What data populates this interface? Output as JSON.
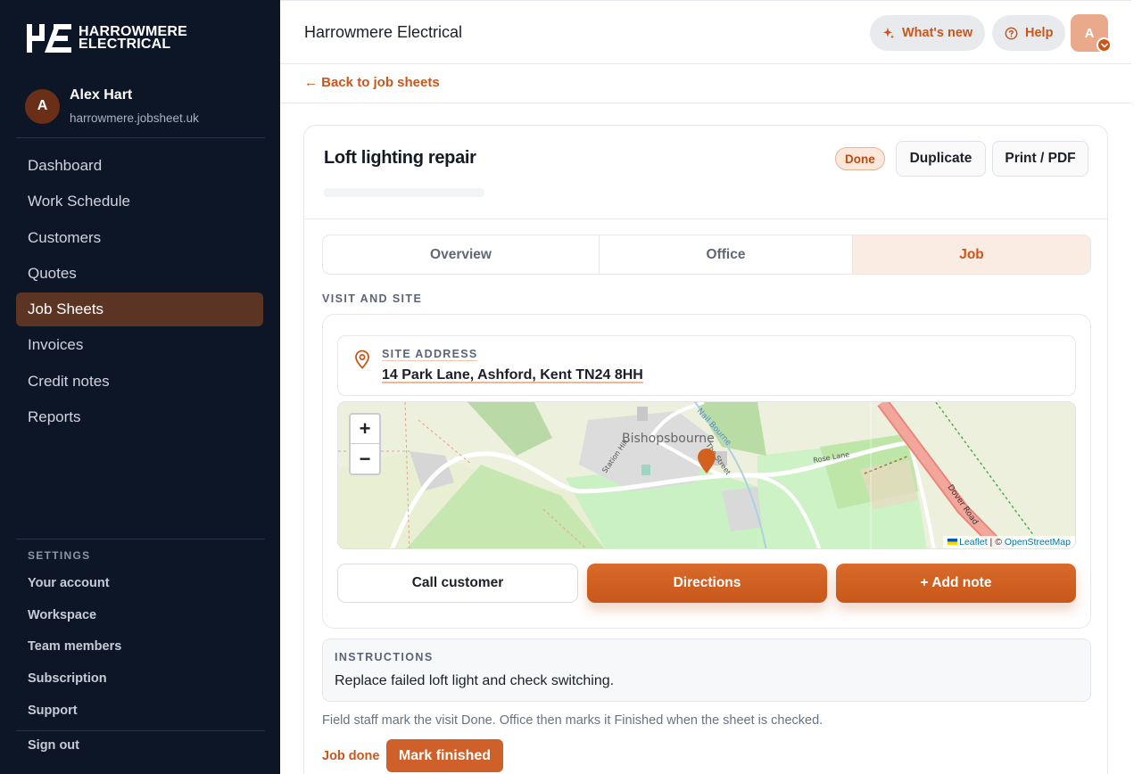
{
  "brand": {
    "line1": "HARROWMERE",
    "line2": "ELECTRICAL"
  },
  "user": {
    "initial": "A",
    "name": "Alex Hart",
    "domain": "harrowmere.jobsheet.uk"
  },
  "nav": [
    {
      "label": "Dashboard",
      "active": false
    },
    {
      "label": "Work Schedule",
      "active": false
    },
    {
      "label": "Customers",
      "active": false
    },
    {
      "label": "Quotes",
      "active": false
    },
    {
      "label": "Job Sheets",
      "active": true
    },
    {
      "label": "Invoices",
      "active": false
    },
    {
      "label": "Credit notes",
      "active": false
    },
    {
      "label": "Reports",
      "active": false
    }
  ],
  "settings": {
    "heading": "SETTINGS",
    "items": [
      "Your account",
      "Workspace",
      "Team members",
      "Subscription",
      "Support"
    ],
    "sign_out": "Sign out"
  },
  "topbar": {
    "title": "Harrowmere Electrical",
    "whats_new": "What's new",
    "help": "Help",
    "avatar_initial": "A"
  },
  "back_link": "← Back to job sheets",
  "job": {
    "title": "Loft lighting repair",
    "status": "Done",
    "duplicate": "Duplicate",
    "print": "Print / PDF"
  },
  "tabs": [
    {
      "label": "Overview",
      "active": false
    },
    {
      "label": "Office",
      "active": false
    },
    {
      "label": "Job",
      "active": true
    }
  ],
  "visit": {
    "section_label": "VISIT AND SITE",
    "address_label": "SITE ADDRESS",
    "address": "14 Park Lane, Ashford, Kent TN24 8HH",
    "map": {
      "place": "Bishopsbourne",
      "roads": [
        "Station Hill",
        "The Street",
        "Rose Lane",
        "Dover Road",
        "Nail Bourne"
      ],
      "zoom_in": "+",
      "zoom_out": "−",
      "attribution_leaflet": "Leaflet",
      "attribution_sep": " | © ",
      "attribution_osm": "OpenStreetMap"
    },
    "call": "Call customer",
    "directions": "Directions",
    "add_note": "+ Add note"
  },
  "instructions": {
    "label": "INSTRUCTIONS",
    "text": "Replace failed loft light and check switching."
  },
  "footer_note": "Field staff mark the visit Done. Office then marks it Finished when the sheet is checked.",
  "job_done_label": "Job done",
  "mark_finished": "Mark finished",
  "colors": {
    "accent": "#c9571b",
    "sidebar": "#0d1627",
    "active_nav": "#5c3424"
  }
}
